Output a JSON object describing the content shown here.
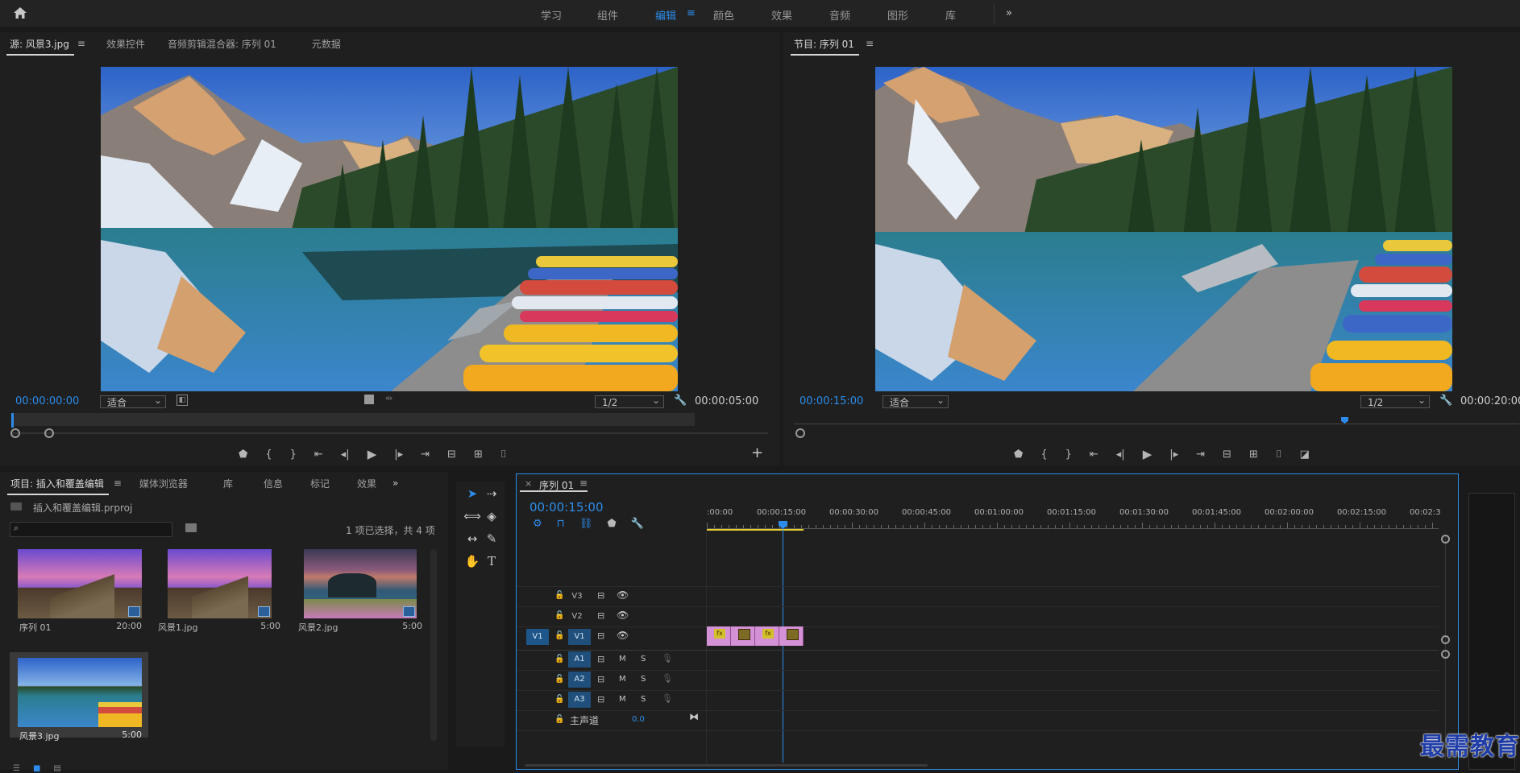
{
  "topbar": {
    "workspaces": [
      "学习",
      "组件",
      "编辑",
      "颜色",
      "效果",
      "音频",
      "图形",
      "库"
    ],
    "active_workspace": "编辑",
    "more": "»"
  },
  "source": {
    "tabs": [
      "源: 风景3.jpg",
      "效果控件",
      "音频剪辑混合器: 序列 01",
      "元数据"
    ],
    "timecode_in": "00:00:00:00",
    "zoom": "适合",
    "resolution": "1/2",
    "duration": "00:00:05:00"
  },
  "program": {
    "tab": "节目: 序列 01",
    "timecode": "00:00:15:00",
    "zoom": "适合",
    "resolution": "1/2",
    "duration": "00:00:20:00"
  },
  "project": {
    "tabs": [
      "项目: 插入和覆盖编辑",
      "媒体浏览器",
      "库",
      "信息",
      "标记",
      "效果"
    ],
    "file": "插入和覆盖编辑.prproj",
    "selection": "1 项已选择，共 4 项",
    "items": [
      {
        "name": "序列 01",
        "duration": "20:00"
      },
      {
        "name": "风景1.jpg",
        "duration": "5:00"
      },
      {
        "name": "风景2.jpg",
        "duration": "5:00"
      },
      {
        "name": "风景3.jpg",
        "duration": "5:00"
      }
    ]
  },
  "timeline": {
    "tab": "序列 01",
    "timecode": "00:00:15:00",
    "ruler": [
      ":00:00",
      "00:00:15:00",
      "00:00:30:00",
      "00:00:45:00",
      "00:01:00:00",
      "00:01:15:00",
      "00:01:30:00",
      "00:01:45:00",
      "00:02:00:00",
      "00:02:15:00",
      "00:02:3"
    ],
    "video_tracks": [
      "V3",
      "V2",
      "V1"
    ],
    "audio_tracks": [
      "A1",
      "A2",
      "A3"
    ],
    "source_patch_v": "V1",
    "master_label": "主声道",
    "master_value": "0.0",
    "mute": "M",
    "solo": "S"
  },
  "watermark": "最需教育",
  "colors": {
    "accent": "#2d8ceb",
    "clip": "#d591d6",
    "track_label": "#1f4f7a"
  }
}
